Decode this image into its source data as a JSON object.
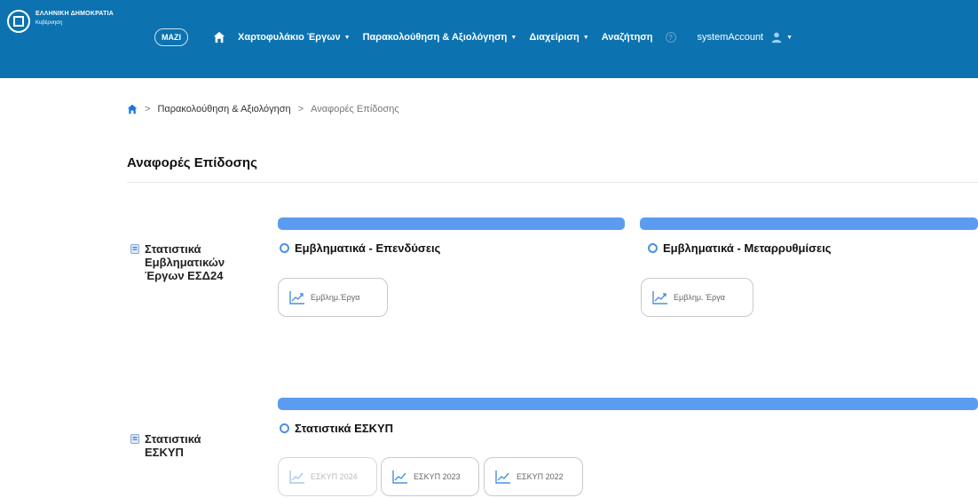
{
  "header": {
    "gov_line1": "ΕΛΛΗΝΙΚΗ ΔΗΜΟΚΡΑΤΙΑ",
    "gov_line2": "Κυβέρνηση",
    "logo": "MAZI",
    "nav": [
      {
        "label": "Χαρτοφυλάκιο Έργων",
        "caret": "▼"
      },
      {
        "label": "Παρακολούθηση & Αξιολόγηση",
        "caret": "▼"
      },
      {
        "label": "Διαχείριση",
        "caret": "▼"
      },
      {
        "label": "Αναζήτηση"
      }
    ],
    "help": "?",
    "account": "systemAccount",
    "account_caret": "▼",
    "colors": {
      "bar": "#0c72b0",
      "text": "#ffffff"
    }
  },
  "breadcrumb": {
    "separator": ">",
    "items": [
      "Παρακολούθηση & Αξιολόγηση",
      "Αναφορές Επίδοσης"
    ]
  },
  "page_title": "Αναφορές Επίδοσης",
  "rows": [
    {
      "label": [
        "Στατιστικά",
        "Εμβληματικών",
        "Έργων ΕΣΔ24"
      ],
      "sections": [
        {
          "title": "Εμβληματικά - Επενδύσεις",
          "buttons": [
            "Εμβλημ.Έργα"
          ]
        },
        {
          "title": "Εμβληματικά - Μεταρρυθμίσεις",
          "buttons": [
            "Εμβλημ. Έργα"
          ]
        }
      ]
    },
    {
      "label": [
        "Στατιστικά",
        "ΕΣΚΥΠ"
      ],
      "sections": [
        {
          "title": "Στατιστικά ΕΣΚΥΠ",
          "buttons": [
            "ΕΣΚΥΠ 2024",
            "ΕΣΚΥΠ 2023",
            "ΕΣΚΥΠ 2022"
          ]
        }
      ]
    }
  ],
  "colors": {
    "accent_bar": "#5b9cf0",
    "radio": "#4a90e2"
  }
}
